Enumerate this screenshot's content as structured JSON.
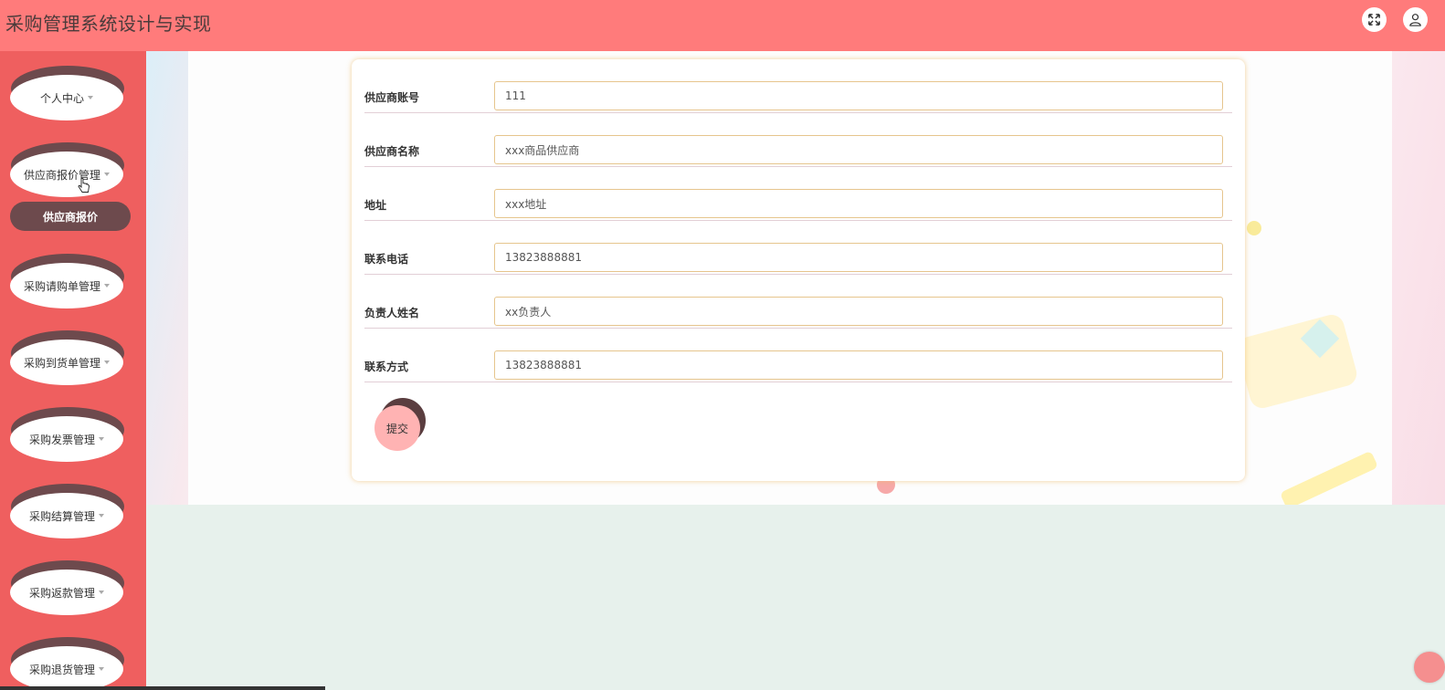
{
  "header": {
    "title": "采购管理系统设计与实现",
    "fullscreen_icon": "expand-icon",
    "user_icon": "user-icon"
  },
  "sidebar": {
    "items": [
      {
        "label": "个人中心"
      },
      {
        "label": "供应商报价管理"
      },
      {
        "label": "采购请购单管理"
      },
      {
        "label": "采购到货单管理"
      },
      {
        "label": "采购发票管理"
      },
      {
        "label": "采购结算管理"
      },
      {
        "label": "采购返款管理"
      },
      {
        "label": "采购退货管理"
      }
    ],
    "submenu": {
      "label": "供应商报价"
    }
  },
  "form": {
    "fields": [
      {
        "label": "供应商账号",
        "value": "111"
      },
      {
        "label": "供应商名称",
        "value": "xxx商品供应商"
      },
      {
        "label": "地址",
        "value": "xxx地址"
      },
      {
        "label": "联系电话",
        "value": "13823888881"
      },
      {
        "label": "负责人姓名",
        "value": "xx负责人"
      },
      {
        "label": "联系方式",
        "value": "13823888881"
      }
    ],
    "submit_label": "提交"
  },
  "colors": {
    "header": "#ff7b7b",
    "sidebar": "#ef5f5f",
    "accent_dark": "#6d4a4d",
    "input_border": "#e6c58d",
    "submit": "#ffb3b3"
  }
}
